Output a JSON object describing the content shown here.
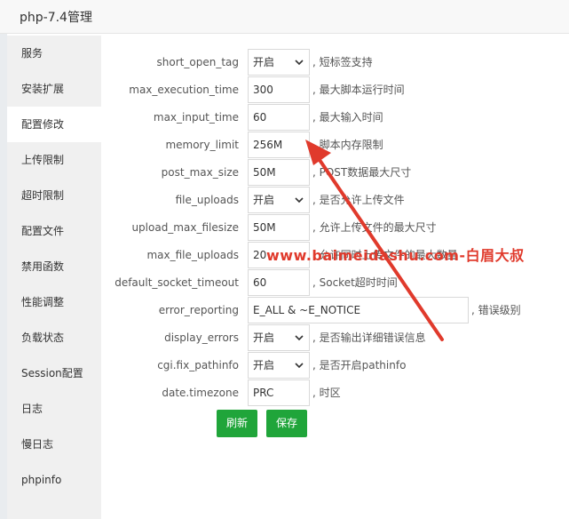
{
  "window": {
    "title": "php-7.4管理"
  },
  "sidebar": {
    "items": [
      {
        "label": "服务"
      },
      {
        "label": "安装扩展"
      },
      {
        "label": "配置修改",
        "active": true
      },
      {
        "label": "上传限制"
      },
      {
        "label": "超时限制"
      },
      {
        "label": "配置文件"
      },
      {
        "label": "禁用函数"
      },
      {
        "label": "性能调整"
      },
      {
        "label": "负载状态"
      },
      {
        "label": "Session配置"
      },
      {
        "label": "日志"
      },
      {
        "label": "慢日志"
      },
      {
        "label": "phpinfo"
      }
    ]
  },
  "config": {
    "rows": [
      {
        "label": "short_open_tag",
        "type": "select",
        "value": "开启",
        "desc": ", 短标签支持"
      },
      {
        "label": "max_execution_time",
        "type": "input",
        "value": "300",
        "desc": ", 最大脚本运行时间"
      },
      {
        "label": "max_input_time",
        "type": "input",
        "value": "60",
        "desc": ", 最大输入时间"
      },
      {
        "label": "memory_limit",
        "type": "input",
        "value": "256M",
        "desc": ", 脚本内存限制"
      },
      {
        "label": "post_max_size",
        "type": "input",
        "value": "50M",
        "desc": ", POST数据最大尺寸"
      },
      {
        "label": "file_uploads",
        "type": "select",
        "value": "开启",
        "desc": ", 是否允许上传文件"
      },
      {
        "label": "upload_max_filesize",
        "type": "input",
        "value": "50M",
        "desc": ", 允许上传文件的最大尺寸"
      },
      {
        "label": "max_file_uploads",
        "type": "input",
        "value": "20",
        "desc": ", 允许同时上传文件的最大数量"
      },
      {
        "label": "default_socket_timeout",
        "type": "input",
        "value": "60",
        "desc": ", Socket超时时间"
      },
      {
        "label": "error_reporting",
        "type": "input",
        "wide": true,
        "value": "E_ALL & ~E_NOTICE",
        "desc": ", 错误级别"
      },
      {
        "label": "display_errors",
        "type": "select",
        "value": "开启",
        "desc": ", 是否输出详细错误信息"
      },
      {
        "label": "cgi.fix_pathinfo",
        "type": "select",
        "value": "开启",
        "desc": ", 是否开启pathinfo"
      },
      {
        "label": "date.timezone",
        "type": "input",
        "value": "PRC",
        "desc": ", 时区"
      }
    ]
  },
  "buttons": {
    "refresh": "刷新",
    "save": "保存"
  },
  "watermark": {
    "text": "www.baimeidashu.com-白眉大叔"
  },
  "colors": {
    "primary": "#20a53a",
    "annotation": "#e03a2c"
  },
  "icons": {
    "select_chevron": "chevron-down-icon",
    "annotation": "red-arrow-icon"
  }
}
